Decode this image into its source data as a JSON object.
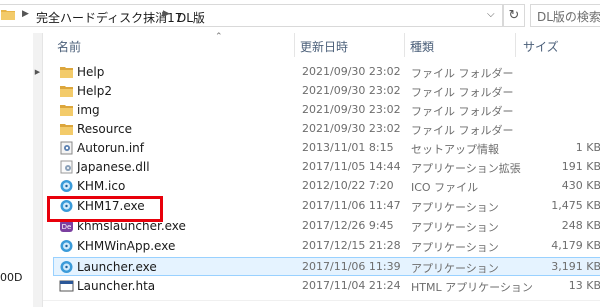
{
  "address_bar": {
    "crumbs": [
      "完全ハードディスク抹消17",
      "DL版"
    ],
    "search_placeholder": "DL版の検索"
  },
  "nav_pane": {
    "truncated_label": "00D"
  },
  "columns": {
    "name": "名前",
    "date": "更新日時",
    "type": "種類",
    "size": "サイズ"
  },
  "files": [
    {
      "name": "Help",
      "date": "2021/09/30 23:02",
      "type": "ファイル フォルダー",
      "size": "",
      "icon": "folder-icon"
    },
    {
      "name": "Help2",
      "date": "2021/09/30 23:02",
      "type": "ファイル フォルダー",
      "size": "",
      "icon": "folder-icon"
    },
    {
      "name": "img",
      "date": "2021/09/30 23:02",
      "type": "ファイル フォルダー",
      "size": "",
      "icon": "folder-icon"
    },
    {
      "name": "Resource",
      "date": "2021/09/30 23:02",
      "type": "ファイル フォルダー",
      "size": "",
      "icon": "folder-icon"
    },
    {
      "name": "Autorun.inf",
      "date": "2013/11/01 8:15",
      "type": "セットアップ情報",
      "size": "1 KB",
      "icon": "setup-info-icon"
    },
    {
      "name": "Japanese.dll",
      "date": "2017/11/05 14:44",
      "type": "アプリケーション拡張",
      "size": "191 KB",
      "icon": "dll-icon"
    },
    {
      "name": "KHM.ico",
      "date": "2012/10/22 7:20",
      "type": "ICO ファイル",
      "size": "430 KB",
      "icon": "khm-icon"
    },
    {
      "name": "KHM17.exe",
      "date": "2017/11/06 11:47",
      "type": "アプリケーション",
      "size": "1,475 KB",
      "icon": "khm-icon"
    },
    {
      "name": "khmslauncher.exe",
      "date": "2017/12/26 9:45",
      "type": "アプリケーション",
      "size": "248 KB",
      "icon": "de-icon"
    },
    {
      "name": "KHMWinApp.exe",
      "date": "2017/12/15 21:28",
      "type": "アプリケーション",
      "size": "4,179 KB",
      "icon": "khm-icon"
    },
    {
      "name": "Launcher.exe",
      "date": "2017/11/06 11:39",
      "type": "アプリケーション",
      "size": "3,191 KB",
      "icon": "khm-icon"
    },
    {
      "name": "Launcher.hta",
      "date": "2017/11/04 21:24",
      "type": "HTML アプリケーション",
      "size": "13 KB",
      "icon": "hta-icon"
    }
  ],
  "colors": {
    "highlight": "#e8000b",
    "selection_bg": "#e5f3ff",
    "selection_border": "#99d1ff",
    "folder": "#e8b547"
  }
}
